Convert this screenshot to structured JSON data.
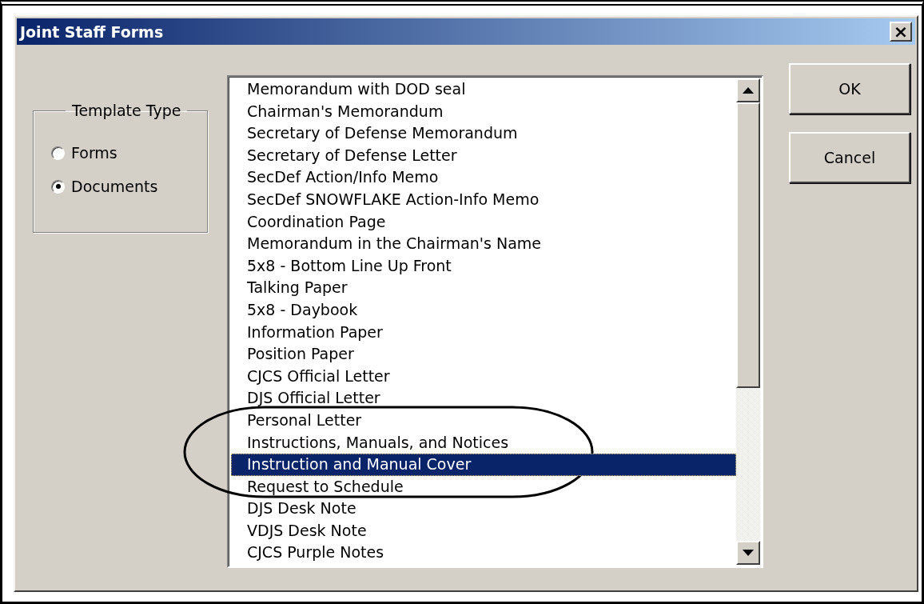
{
  "window": {
    "title": "Joint Staff Forms",
    "close": "×"
  },
  "template_type": {
    "label": "Template Type",
    "options": [
      {
        "label": "Forms",
        "selected": false
      },
      {
        "label": "Documents",
        "selected": true
      }
    ]
  },
  "list": {
    "items": [
      {
        "label": "Memorandum with DOD seal",
        "selected": false
      },
      {
        "label": "Chairman's Memorandum",
        "selected": false
      },
      {
        "label": "Secretary of Defense Memorandum",
        "selected": false
      },
      {
        "label": "Secretary of Defense Letter",
        "selected": false
      },
      {
        "label": "SecDef Action/Info Memo",
        "selected": false
      },
      {
        "label": "SecDef SNOWFLAKE Action-Info Memo",
        "selected": false
      },
      {
        "label": "Coordination Page",
        "selected": false
      },
      {
        "label": "Memorandum in the Chairman's Name",
        "selected": false
      },
      {
        "label": "5x8 - Bottom Line Up Front",
        "selected": false
      },
      {
        "label": "Talking Paper",
        "selected": false
      },
      {
        "label": "5x8 - Daybook",
        "selected": false
      },
      {
        "label": "Information Paper",
        "selected": false
      },
      {
        "label": "Position Paper",
        "selected": false
      },
      {
        "label": "CJCS Official Letter",
        "selected": false
      },
      {
        "label": "DJS Official Letter",
        "selected": false
      },
      {
        "label": "Personal Letter",
        "selected": false
      },
      {
        "label": "Instructions, Manuals, and Notices",
        "selected": false
      },
      {
        "label": "Instruction and Manual Cover",
        "selected": true
      },
      {
        "label": "Request to Schedule",
        "selected": false
      },
      {
        "label": "DJS Desk Note",
        "selected": false
      },
      {
        "label": "VDJS Desk Note",
        "selected": false
      },
      {
        "label": "CJCS Purple Notes",
        "selected": false
      }
    ]
  },
  "buttons": [
    "OK",
    "Cancel"
  ]
}
